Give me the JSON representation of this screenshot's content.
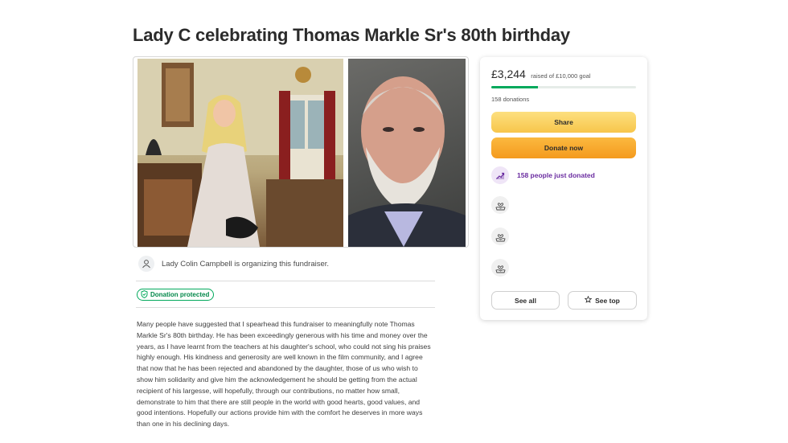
{
  "page": {
    "title": "Lady C celebrating Thomas Markle Sr's 80th birthday"
  },
  "organizer": {
    "text": "Lady Colin Campbell is organizing this fundraiser."
  },
  "badge": {
    "label": "Donation protected"
  },
  "story": {
    "text": "Many people have suggested that I spearhead this fundraiser to meaningfully note Thomas Markle Sr's 80th birthday. He has been exceedingly generous with his time and money over the years, as I have learnt from the teachers at his daughter's school, who could not sing his praises highly enough. His kindness and generosity are well known in the film community, and I agree that now that he has been rejected and abandoned by the daughter, those of us who wish to show him solidarity and give him the acknowledgement he should be getting from the actual recipient of his largesse, will hopefully, through our contributions, no matter how small, demonstrate to him that there are still people in the world with good hearts, good values, and good intentions. Hopefully our actions provide him with the comfort he deserves in more ways than one in his declining days."
  },
  "card": {
    "amount": "£3,244",
    "goal_text": "raised of £10,000 goal",
    "progress_fraction": 0.3244,
    "donations": "158 donations",
    "share_label": "Share",
    "donate_label": "Donate now",
    "recent_text": "158 people just donated",
    "see_all_label": "See all",
    "see_top_label": "See top"
  },
  "icons": {
    "organizer": "user-icon",
    "badge": "shield-check-icon",
    "recent": "trending-up-icon",
    "donor": "heart-hands-icon",
    "see_top": "star-icon"
  },
  "colors": {
    "green": "#02a95c",
    "share": "#f7c64b",
    "donate": "#f49a1e",
    "purple": "#6a2ca0"
  }
}
